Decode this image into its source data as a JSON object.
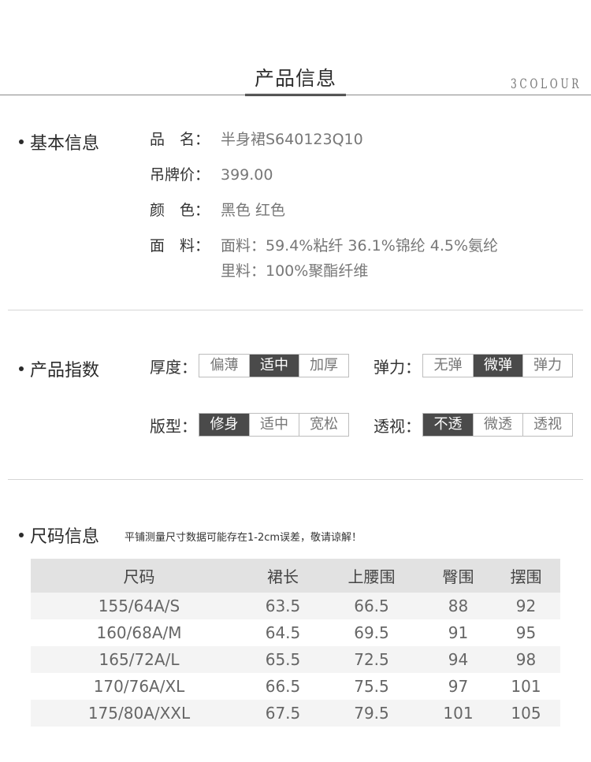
{
  "header": {
    "title": "产品信息",
    "brand": "3COLOUR"
  },
  "basic_info": {
    "heading": "基本信息",
    "rows": [
      {
        "label": "品　名",
        "value": "半身裙S640123Q10"
      },
      {
        "label": "吊牌价",
        "value": "399.00"
      },
      {
        "label": "颜　色",
        "value": "黑色 红色"
      },
      {
        "label": "面　料",
        "value": "面料：59.4%粘纤 36.1%锦纶 4.5%氨纶",
        "value2": "里料：100%聚酯纤维"
      }
    ],
    "colon": "："
  },
  "product_index": {
    "heading": "产品指数",
    "groups": [
      {
        "label": "厚度：",
        "options": [
          "偏薄",
          "适中",
          "加厚"
        ],
        "selected": 1
      },
      {
        "label": "弹力：",
        "options": [
          "无弹",
          "微弹",
          "弹力"
        ],
        "selected": 1
      },
      {
        "label": "版型：",
        "options": [
          "修身",
          "适中",
          "宽松"
        ],
        "selected": 0
      },
      {
        "label": "透视：",
        "options": [
          "不透",
          "微透",
          "透视"
        ],
        "selected": 0
      }
    ]
  },
  "size_info": {
    "heading": "尺码信息",
    "note": "平铺测量尺寸数据可能存在1-2cm误差，敬请谅解！",
    "columns": [
      "尺码",
      "裙长",
      "上腰围",
      "臀围",
      "摆围"
    ],
    "rows": [
      [
        "155/64A/S",
        "63.5",
        "66.5",
        "88",
        "92"
      ],
      [
        "160/68A/M",
        "64.5",
        "69.5",
        "91",
        "95"
      ],
      [
        "165/72A/L",
        "65.5",
        "72.5",
        "94",
        "98"
      ],
      [
        "170/76A/XL",
        "66.5",
        "75.5",
        "97",
        "101"
      ],
      [
        "175/80A/XXL",
        "67.5",
        "79.5",
        "101",
        "105"
      ]
    ]
  },
  "colors": {
    "active_option_bg": "#4a4a4a",
    "table_header_bg": "#e2e2e2",
    "stripe_bg": "#f4f4f4"
  }
}
